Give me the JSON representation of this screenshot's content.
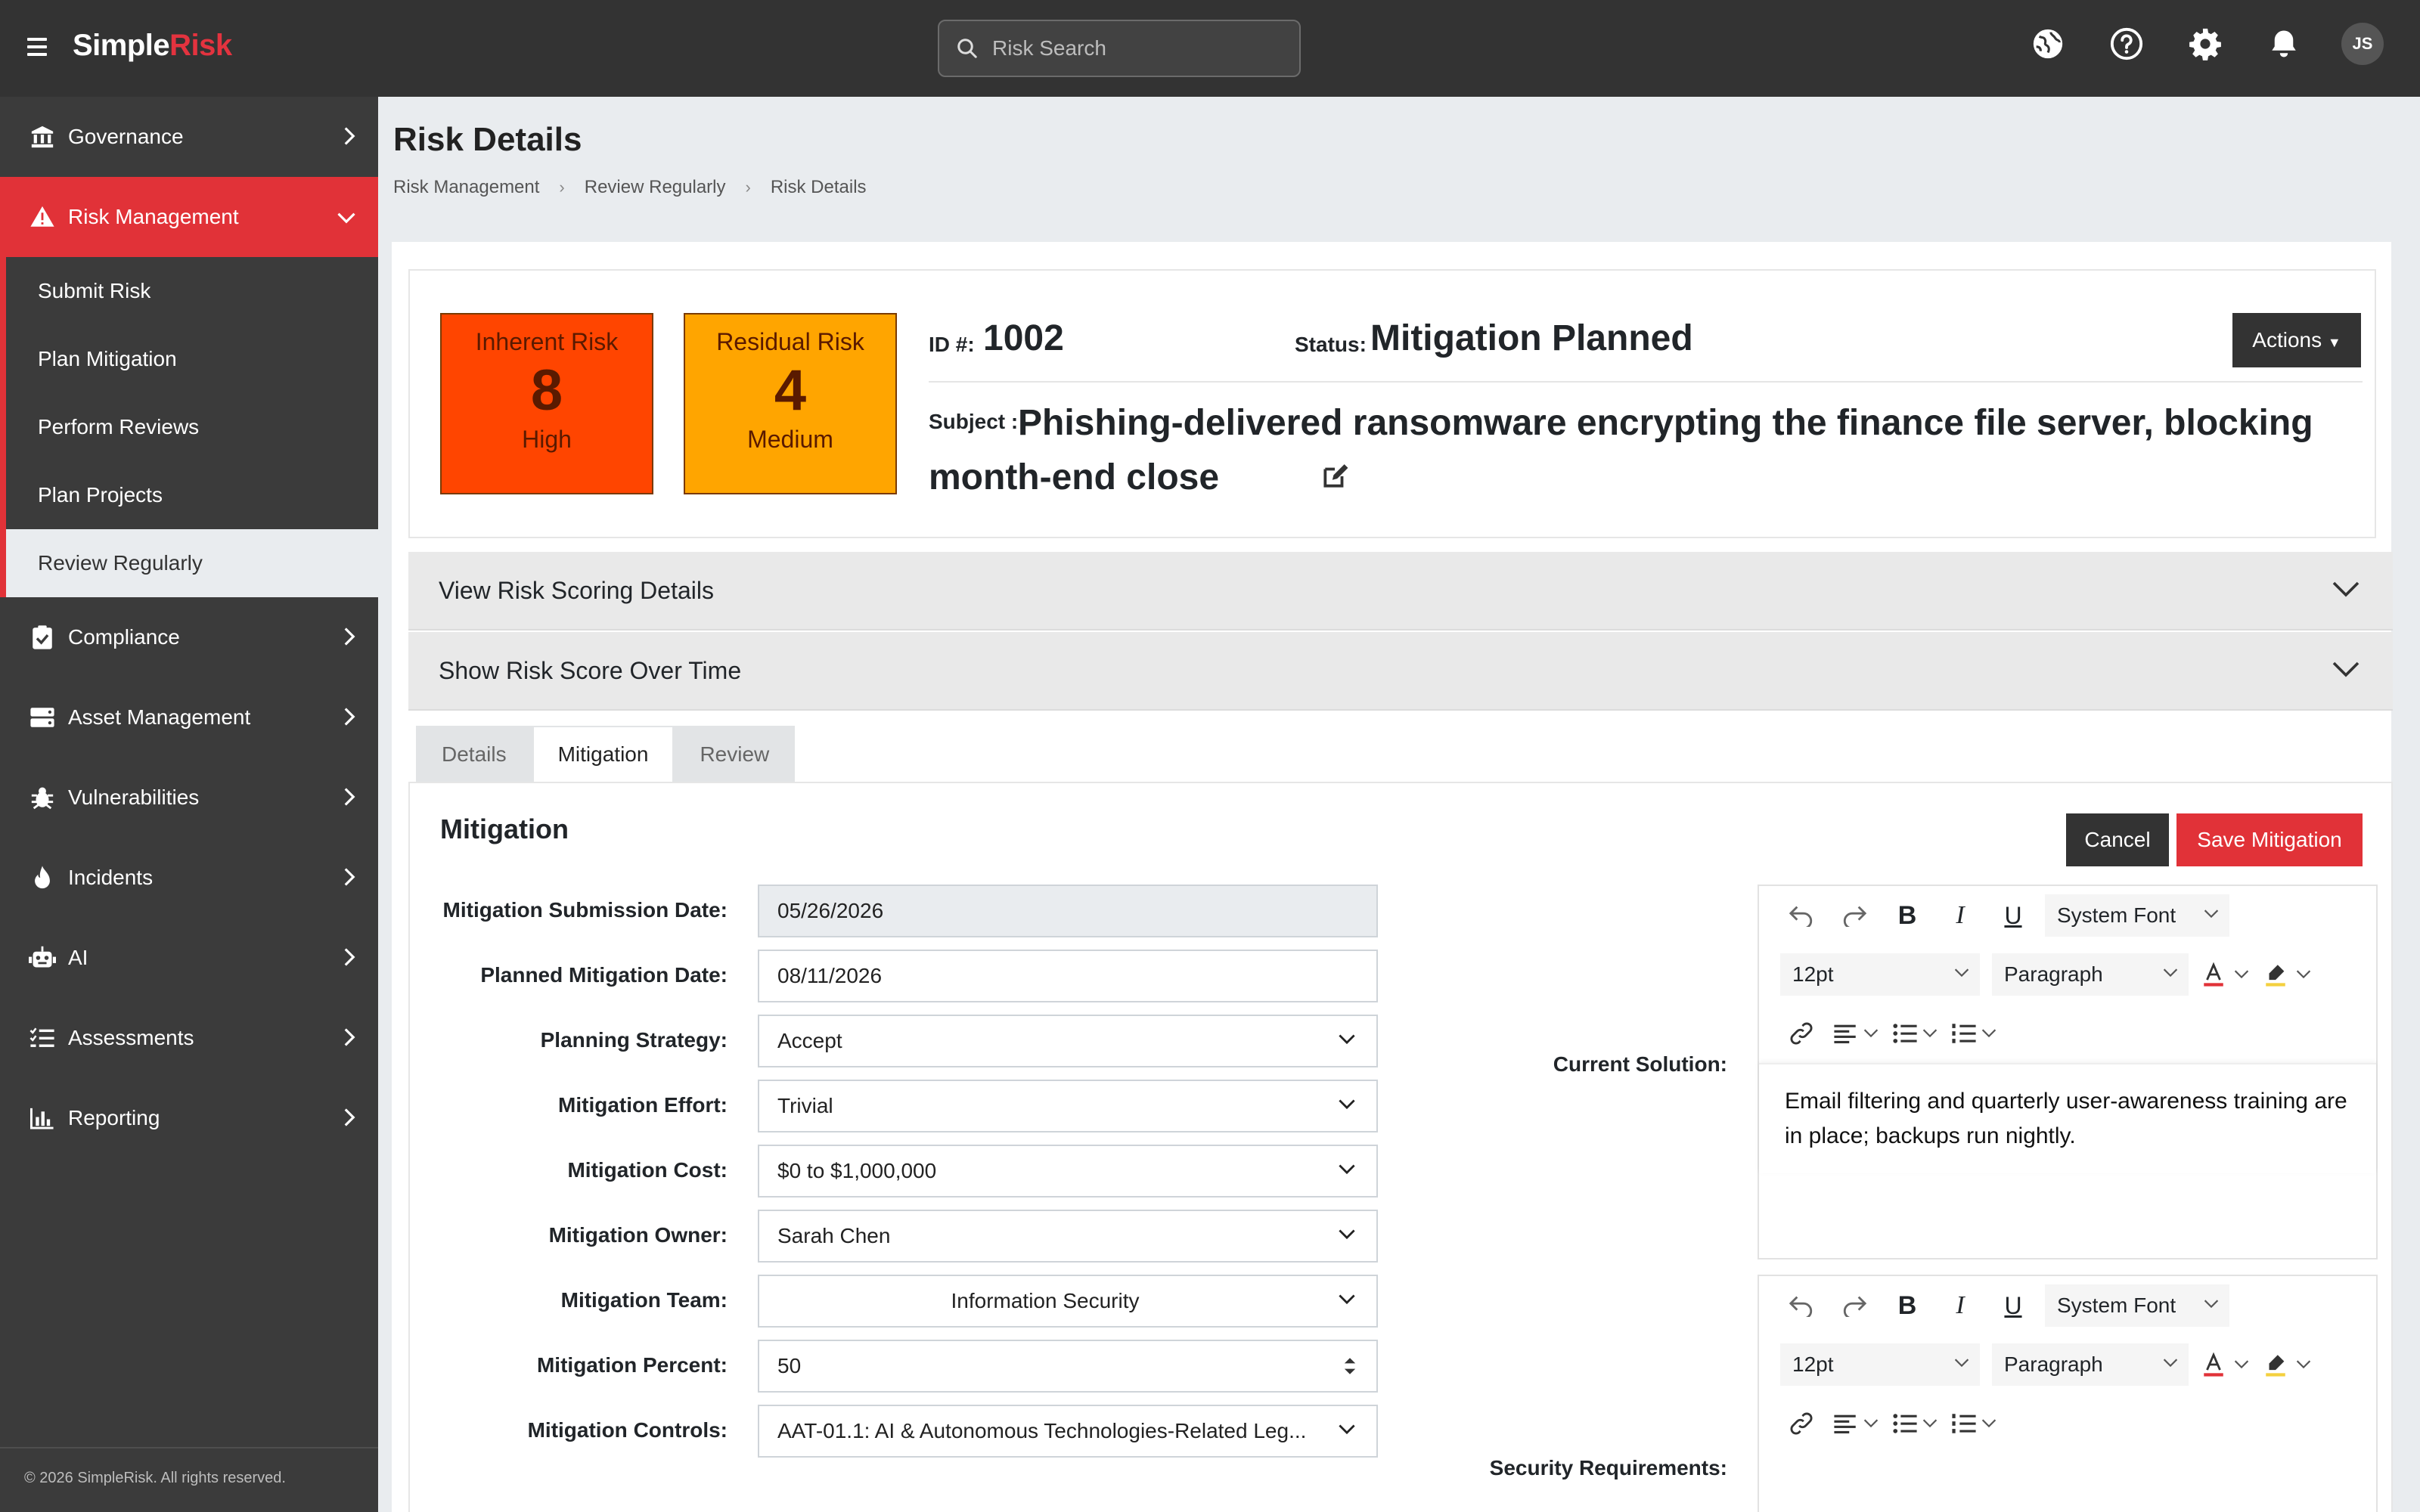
{
  "app": {
    "logo_main": "Simple",
    "logo_accent": "Risk",
    "user_initials": "JS"
  },
  "search": {
    "placeholder": "Risk Search"
  },
  "sidebar": {
    "items": [
      {
        "label": "Governance"
      },
      {
        "label": "Risk Management"
      },
      {
        "label": "Compliance"
      },
      {
        "label": "Asset Management"
      },
      {
        "label": "Vulnerabilities"
      },
      {
        "label": "Incidents"
      },
      {
        "label": "AI"
      },
      {
        "label": "Assessments"
      },
      {
        "label": "Reporting"
      }
    ],
    "sub_items": [
      {
        "label": "Submit Risk"
      },
      {
        "label": "Plan Mitigation"
      },
      {
        "label": "Perform Reviews"
      },
      {
        "label": "Plan Projects"
      },
      {
        "label": "Review Regularly"
      }
    ],
    "copyright": "© 2026 SimpleRisk. All rights reserved."
  },
  "page": {
    "title": "Risk Details",
    "breadcrumb": [
      "Risk Management",
      "Review Regularly",
      "Risk Details"
    ]
  },
  "risk": {
    "inherent": {
      "label": "Inherent Risk",
      "score": "8",
      "level": "High",
      "color": "#ff4500"
    },
    "residual": {
      "label": "Residual Risk",
      "score": "4",
      "level": "Medium",
      "color": "#ffa500"
    },
    "id_label": "ID #:",
    "id": "1002",
    "status_label": "Status:",
    "status": "Mitigation Planned",
    "actions_label": "Actions",
    "subject_label": "Subject :",
    "subject": "Phishing-delivered ransomware encrypting the finance file server, blocking month-end close"
  },
  "accordions": [
    {
      "label": "View Risk Scoring Details"
    },
    {
      "label": "Show Risk Score Over Time"
    }
  ],
  "tabs": [
    {
      "label": "Details"
    },
    {
      "label": "Mitigation"
    },
    {
      "label": "Review"
    }
  ],
  "mitigation": {
    "title": "Mitigation",
    "cancel_label": "Cancel",
    "save_label": "Save Mitigation",
    "fields": [
      {
        "label": "Mitigation Submission Date:",
        "value": "05/26/2026"
      },
      {
        "label": "Planned Mitigation Date:",
        "value": "08/11/2026"
      },
      {
        "label": "Planning Strategy:",
        "value": "Accept"
      },
      {
        "label": "Mitigation Effort:",
        "value": "Trivial"
      },
      {
        "label": "Mitigation Cost:",
        "value": "$0 to $1,000,000"
      },
      {
        "label": "Mitigation Owner:",
        "value": "Sarah Chen"
      },
      {
        "label": "Mitigation Team:",
        "value": "Information Security"
      },
      {
        "label": "Mitigation Percent:",
        "value": "50"
      },
      {
        "label": "Mitigation Controls:",
        "value": "AAT-01.1: AI & Autonomous Technologies-Related Leg..."
      }
    ],
    "current_solution_label": "Current Solution:",
    "current_solution_text": "Email filtering and quarterly user-awareness training are in place; backups run nightly.",
    "security_requirements_label": "Security Requirements:"
  },
  "editor": {
    "font": "System Font",
    "size": "12pt",
    "block": "Paragraph"
  },
  "colors": {
    "accent": "#e13238",
    "topbar": "#333333",
    "sidebar": "#3b3b3b"
  }
}
